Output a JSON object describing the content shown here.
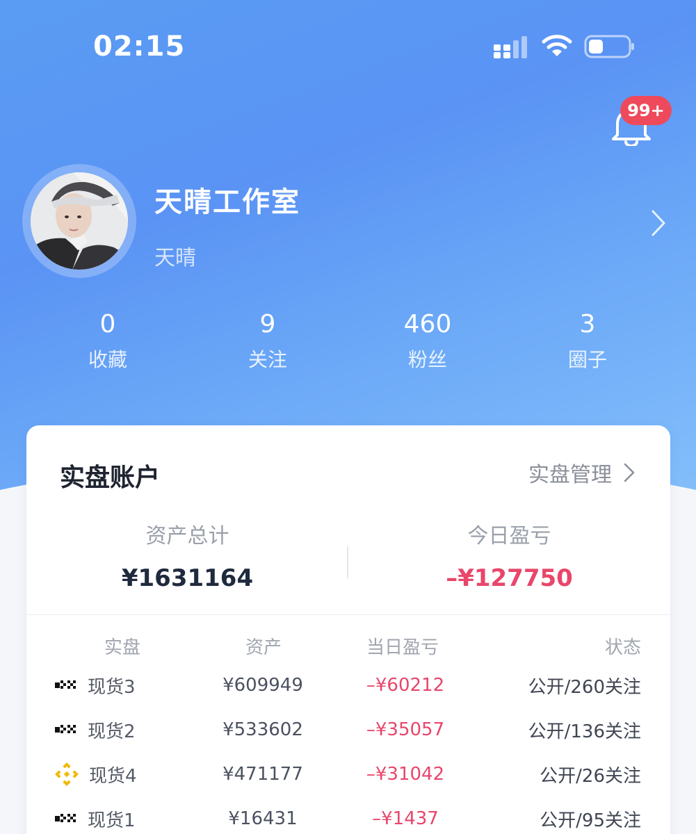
{
  "status_bar": {
    "time": "02:15"
  },
  "notifications": {
    "badge": "99+"
  },
  "profile": {
    "name": "天晴工作室",
    "subtitle": "天晴"
  },
  "stats": [
    {
      "value": "0",
      "label": "收藏"
    },
    {
      "value": "9",
      "label": "关注"
    },
    {
      "value": "460",
      "label": "粉丝"
    },
    {
      "value": "3",
      "label": "圈子"
    }
  ],
  "account_card": {
    "title": "实盘账户",
    "manage_label": "实盘管理",
    "summary": {
      "total_assets_label": "资产总计",
      "total_assets_value": "¥1631164",
      "today_pnl_label": "今日盈亏",
      "today_pnl_value": "–¥127750"
    },
    "table": {
      "headers": [
        "实盘",
        "资产",
        "当日盈亏",
        "状态"
      ],
      "rows": [
        {
          "exchange_icon": "okx-logo",
          "name": "现货3",
          "asset": "¥609949",
          "pnl": "–¥60212",
          "status": "公开/260关注"
        },
        {
          "exchange_icon": "okx-logo",
          "name": "现货2",
          "asset": "¥533602",
          "pnl": "–¥35057",
          "status": "公开/136关注"
        },
        {
          "exchange_icon": "binance-logo",
          "name": "现货4",
          "asset": "¥471177",
          "pnl": "–¥31042",
          "status": "公开/26关注"
        },
        {
          "exchange_icon": "okx-logo",
          "name": "现货1",
          "asset": "¥16431",
          "pnl": "–¥1437",
          "status": "公开/95关注"
        }
      ]
    }
  },
  "colors": {
    "gradient_start": "#5a9cf3",
    "gradient_end": "#86c1fb",
    "negative": "#e8466b",
    "badge": "#ef4a5b"
  }
}
